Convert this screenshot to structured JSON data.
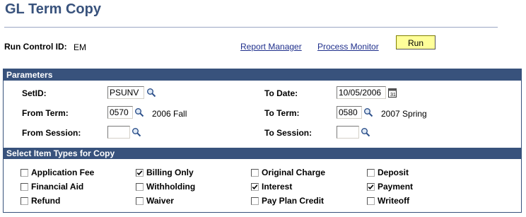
{
  "page": {
    "title": "GL Term Copy"
  },
  "run_control": {
    "label": "Run Control ID:",
    "value": "EM"
  },
  "links": {
    "report_manager": "Report Manager",
    "process_monitor": "Process Monitor"
  },
  "run_button": {
    "label": "Run"
  },
  "parameters": {
    "header": "Parameters",
    "setid_label": "SetID:",
    "setid_value": "PSUNV",
    "to_date_label": "To Date:",
    "to_date_value": "10/05/2006",
    "from_term_label": "From Term:",
    "from_term_value": "0570",
    "from_term_desc": "2006 Fall",
    "to_term_label": "To Term:",
    "to_term_value": "0580",
    "to_term_desc": "2007 Spring",
    "from_session_label": "From Session:",
    "from_session_value": "",
    "to_session_label": "To Session:",
    "to_session_value": ""
  },
  "item_types": {
    "header": "Select Item Types for Copy",
    "items": [
      {
        "label": "Application Fee",
        "checked": false
      },
      {
        "label": "Billing Only",
        "checked": true
      },
      {
        "label": "Original Charge",
        "checked": false
      },
      {
        "label": "Deposit",
        "checked": false
      },
      {
        "label": "Financial Aid",
        "checked": false
      },
      {
        "label": "Withholding",
        "checked": false
      },
      {
        "label": "Interest",
        "checked": true
      },
      {
        "label": "Payment",
        "checked": true
      },
      {
        "label": "Refund",
        "checked": false
      },
      {
        "label": "Waiver",
        "checked": false
      },
      {
        "label": "Pay Plan Credit",
        "checked": false
      },
      {
        "label": "Writeoff",
        "checked": false
      }
    ]
  },
  "colors": {
    "header_bg": "#38527c",
    "title": "#38527c",
    "link": "#1f2f8c",
    "run_button_bg": "#ffff99"
  },
  "icons": {
    "lookup": "magnifier-lookup-icon",
    "calendar": "calendar-icon",
    "checkmark": "checkmark-icon"
  }
}
